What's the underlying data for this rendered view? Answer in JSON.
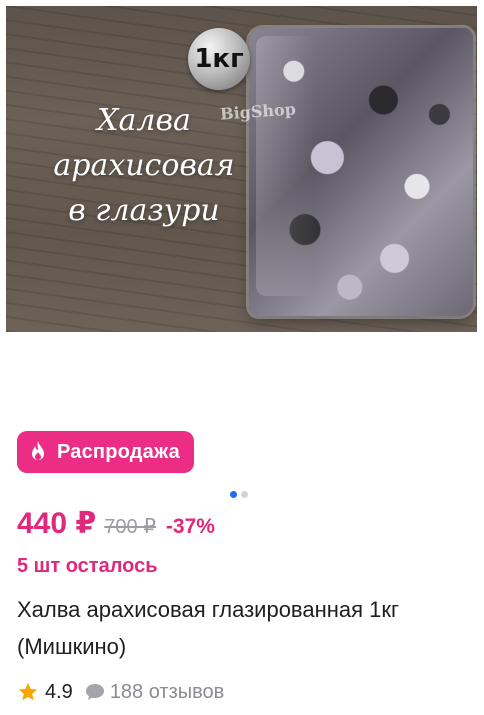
{
  "product": {
    "image": {
      "weight_badge": "1кг",
      "watermark": "BigShop",
      "caption_lines": [
        "Халва",
        "арахисовая",
        "в глазури"
      ]
    },
    "sale_badge": {
      "label": "Распродажа",
      "icon": "fire-icon",
      "color": "#ec2d86"
    },
    "carousel": {
      "current": 1,
      "total": 2
    },
    "price": {
      "current": "440 ₽",
      "old": "700 ₽",
      "discount": "-37%",
      "accent_color": "#e0287c"
    },
    "stock_text": "5 шт осталось",
    "title": "Халва арахисовая глазированная 1кг (Мишкино)",
    "rating": {
      "value": "4.9",
      "icon": "star-icon",
      "reviews_text": "188 отзывов",
      "reviews_icon": "chat-bubble-icon"
    }
  }
}
